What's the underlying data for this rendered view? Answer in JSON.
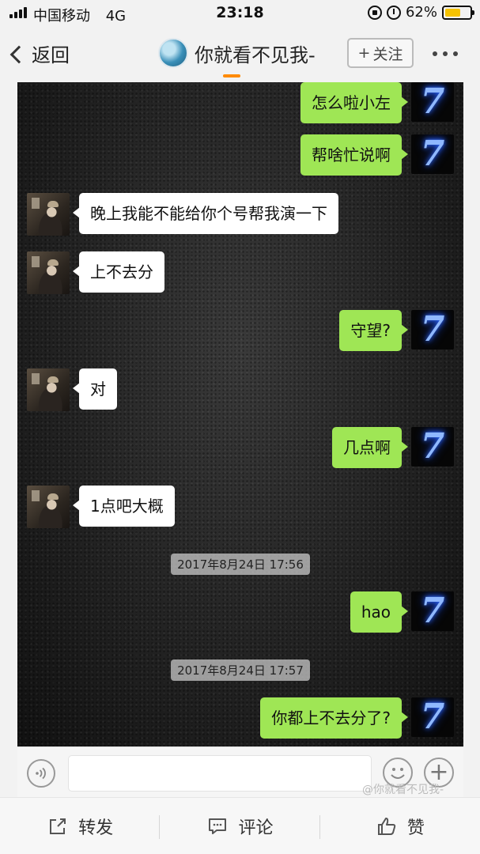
{
  "status_bar": {
    "carrier": "中国移动",
    "network": "4G",
    "time": "23:18",
    "battery_percent": "62%",
    "battery_level": 0.62
  },
  "nav": {
    "back_label": "返回",
    "title": "你就看不见我-",
    "follow_label": "关注",
    "follow_plus": "+",
    "more_icon": "more-dots-icon"
  },
  "messages": [
    {
      "side": "me",
      "text": "怎么啦小左"
    },
    {
      "side": "me",
      "text": "帮啥忙说啊"
    },
    {
      "side": "friend",
      "text": "晚上我能不能给你个号帮我演一下"
    },
    {
      "side": "friend",
      "text": "上不去分"
    },
    {
      "side": "me",
      "text": "守望?"
    },
    {
      "side": "friend",
      "text": "对"
    },
    {
      "side": "me",
      "text": "几点啊"
    },
    {
      "side": "friend",
      "text": "1点吧大概"
    },
    {
      "type": "timestamp",
      "text": "2017年8月24日 17:56"
    },
    {
      "side": "me",
      "text": "hao"
    },
    {
      "type": "timestamp",
      "text": "2017年8月24日 17:57"
    },
    {
      "side": "me",
      "text": "你都上不去分了?"
    }
  ],
  "input_bar": {
    "voice_icon": "voice-icon",
    "emoji_icon": "emoji-icon",
    "plus_icon": "plus-icon"
  },
  "watermark": "@你就看不见我-",
  "footer": {
    "forward_label": "转发",
    "comment_label": "评论",
    "like_label": "赞"
  },
  "colors": {
    "my_bubble": "#9fe655",
    "friend_bubble": "#ffffff",
    "accent": "#ff8a00"
  }
}
